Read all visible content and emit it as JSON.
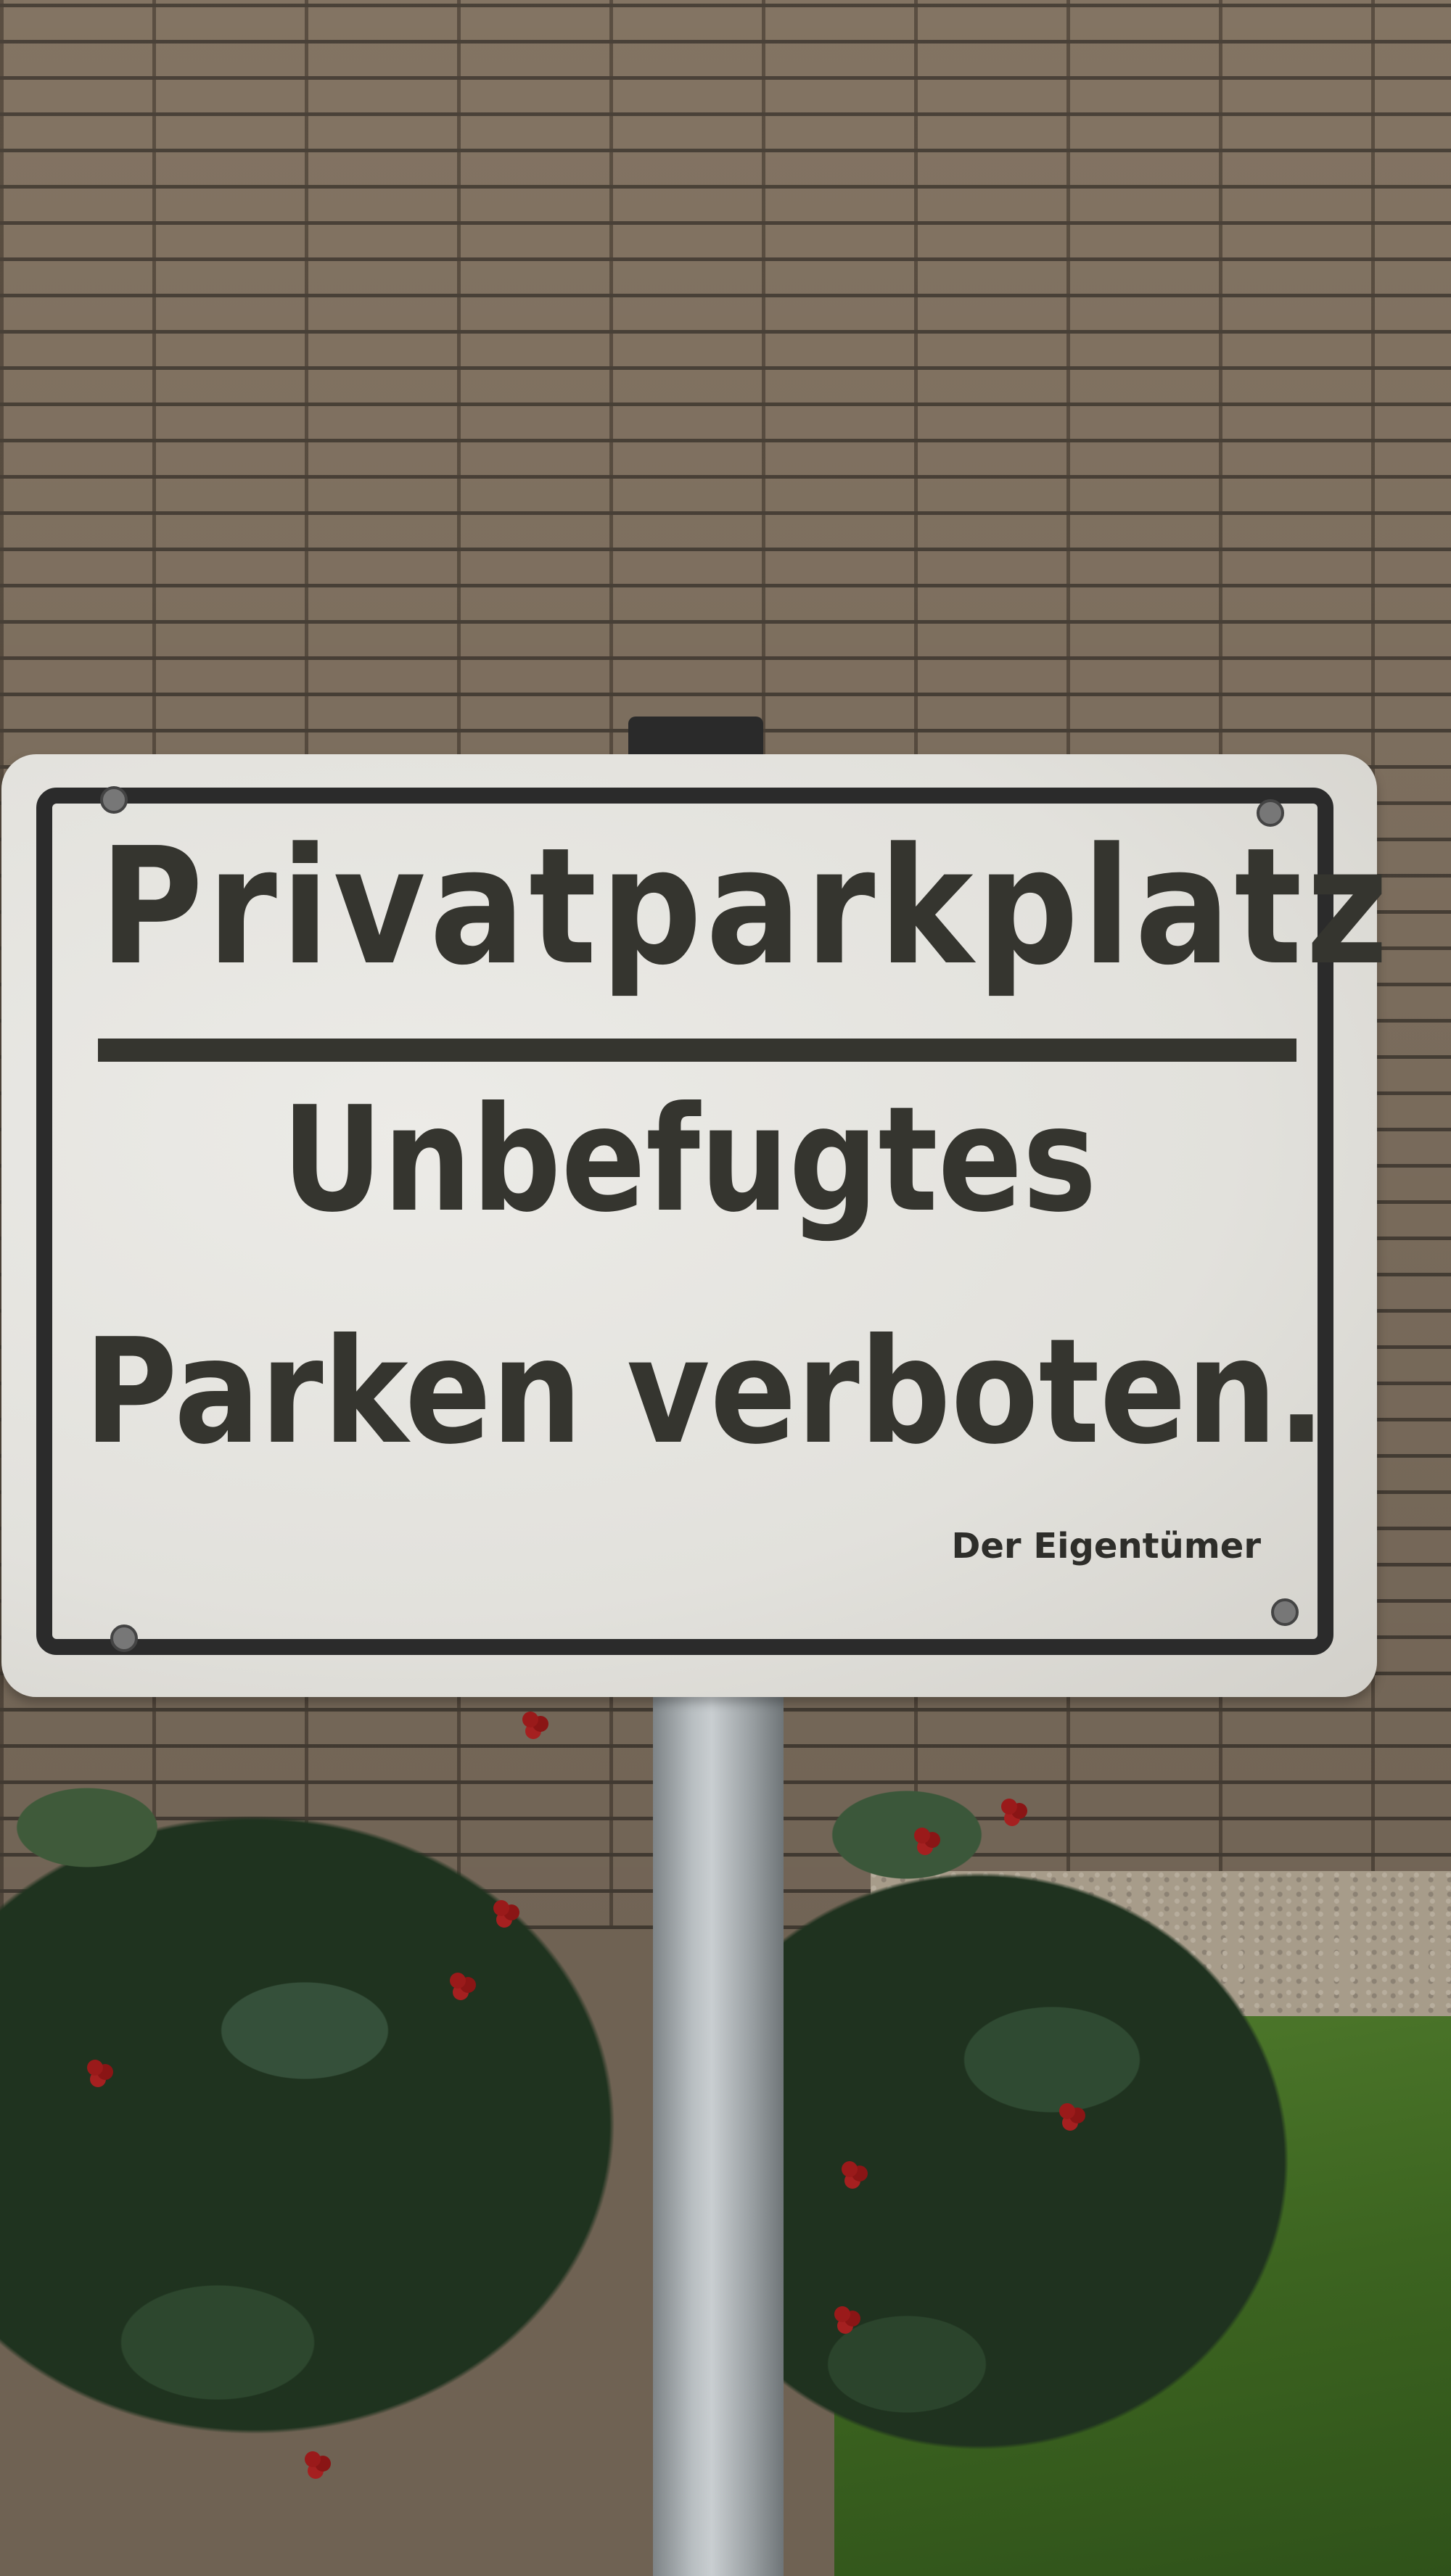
{
  "sign": {
    "title": "Privatparkplatz",
    "line1": "Unbefugtes",
    "line2": "Parken verboten.",
    "owner": "Der Eigentümer"
  },
  "colors": {
    "sign_face": "#e4e3de",
    "sign_text": "#35352f",
    "frame": "#2b2b2b",
    "brick": "#8a7a68",
    "pole": "#b8bec1",
    "foliage": "#1f331f",
    "lawn": "#3c6420",
    "berries": "#9a1a1a"
  }
}
